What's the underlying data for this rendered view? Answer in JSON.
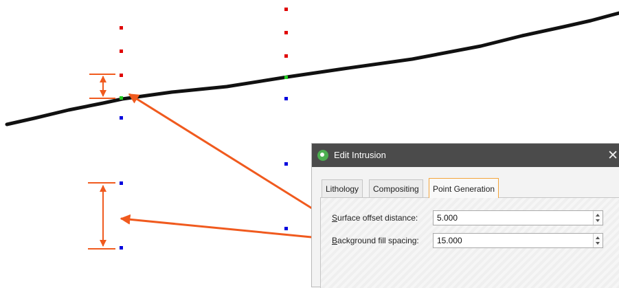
{
  "dialog": {
    "title": "Edit Intrusion",
    "icon": "intrusion-icon",
    "close_glyph": "✕",
    "tabs": [
      {
        "label": "Lithology",
        "active": false
      },
      {
        "label": "Compositing",
        "active": false
      },
      {
        "label": "Point Generation",
        "active": true
      }
    ],
    "fields": {
      "surface_offset": {
        "mnemonic": "S",
        "label_rest": "urface offset distance:",
        "value": "5.000"
      },
      "background_fill": {
        "mnemonic": "B",
        "label_rest": "ackground fill spacing:",
        "value": "15.000"
      }
    }
  },
  "colors": {
    "surface_line": "#111111",
    "above_points": "#e00000",
    "surface_points": "#22cc22",
    "below_points": "#0000dd",
    "annotation": "#f05a1e",
    "active_tab_border": "#f4a43a",
    "titlebar": "#4b4b4b"
  }
}
